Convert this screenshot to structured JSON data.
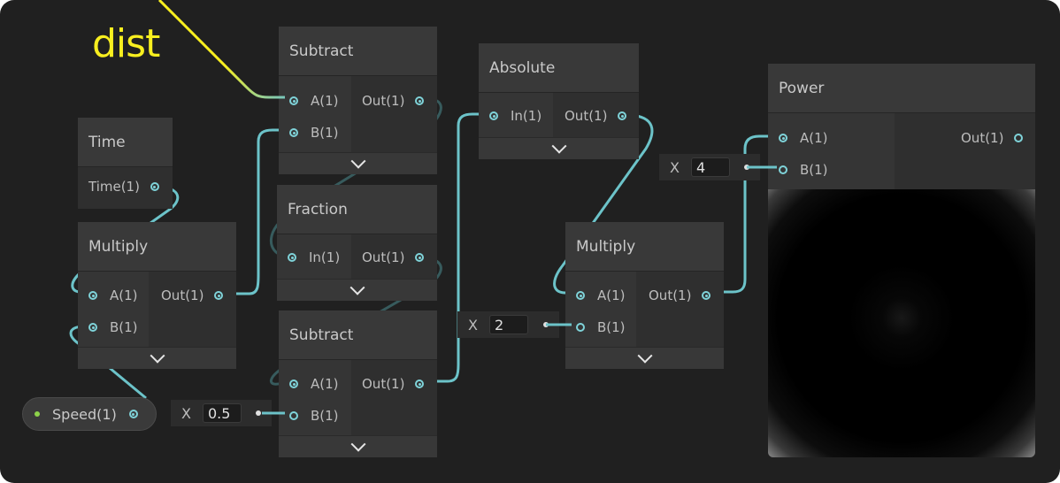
{
  "annotation": {
    "text": "dist",
    "color": "#f8ef1f"
  },
  "wire_color": "#6cc3c9",
  "nodes": {
    "subtract_top": {
      "title": "Subtract",
      "in_a": "A(1)",
      "in_b": "B(1)",
      "out": "Out(1)"
    },
    "time": {
      "title": "Time",
      "out": "Time(1)"
    },
    "fraction": {
      "title": "Fraction",
      "in": "In(1)",
      "out": "Out(1)"
    },
    "absolute": {
      "title": "Absolute",
      "in": "In(1)",
      "out": "Out(1)"
    },
    "multiply_left": {
      "title": "Multiply",
      "in_a": "A(1)",
      "in_b": "B(1)",
      "out": "Out(1)"
    },
    "subtract_bottom": {
      "title": "Subtract",
      "in_a": "A(1)",
      "in_b": "B(1)",
      "out": "Out(1)"
    },
    "multiply_right": {
      "title": "Multiply",
      "in_a": "A(1)",
      "in_b": "B(1)",
      "out": "Out(1)"
    },
    "power": {
      "title": "Power",
      "in_a": "A(1)",
      "in_b": "B(1)",
      "out": "Out(1)"
    }
  },
  "property": {
    "label": "Speed(1)",
    "indicator_color": "#8ed34a"
  },
  "value_inputs": {
    "sub_b": {
      "label": "X",
      "value": "0.5"
    },
    "mul_b": {
      "label": "X",
      "value": "2"
    },
    "pow_b": {
      "label": "X",
      "value": "4"
    }
  }
}
